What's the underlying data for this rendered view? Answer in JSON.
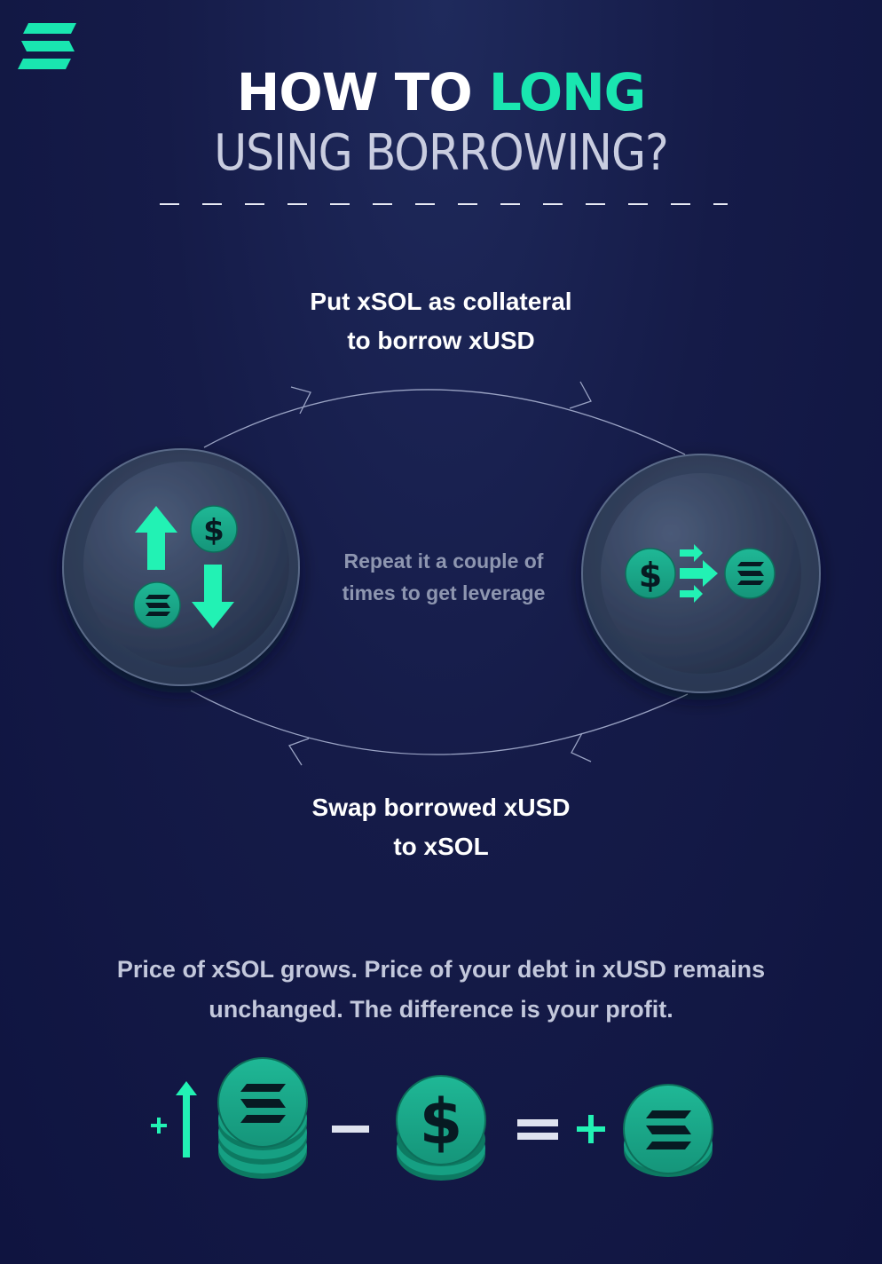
{
  "brand": {
    "accent": "#19e6b0",
    "logo_icon": "brand-s-logo-icon"
  },
  "title": {
    "part1": "HOW TO",
    "part2": "LONG",
    "line2": "USING BORROWING?"
  },
  "cycle": {
    "top_caption_line1": "Put xSOL as collateral",
    "top_caption_line2": "to borrow xUSD",
    "center_line1": "Repeat it a couple of",
    "center_line2": "times to get leverage",
    "bottom_caption_line1": "Swap borrowed xUSD",
    "bottom_caption_line2": "to xSOL"
  },
  "summary": {
    "line1": "Price of xSOL grows. Price of your debt in xUSD remains",
    "line2": "unchanged. The difference is your profit."
  },
  "icons": [
    "up-arrow-icon",
    "down-arrow-icon",
    "dollar-coin-icon",
    "xsol-coin-icon",
    "swap-arrows-icon",
    "minus-icon",
    "equals-icon",
    "plus-icon"
  ]
}
